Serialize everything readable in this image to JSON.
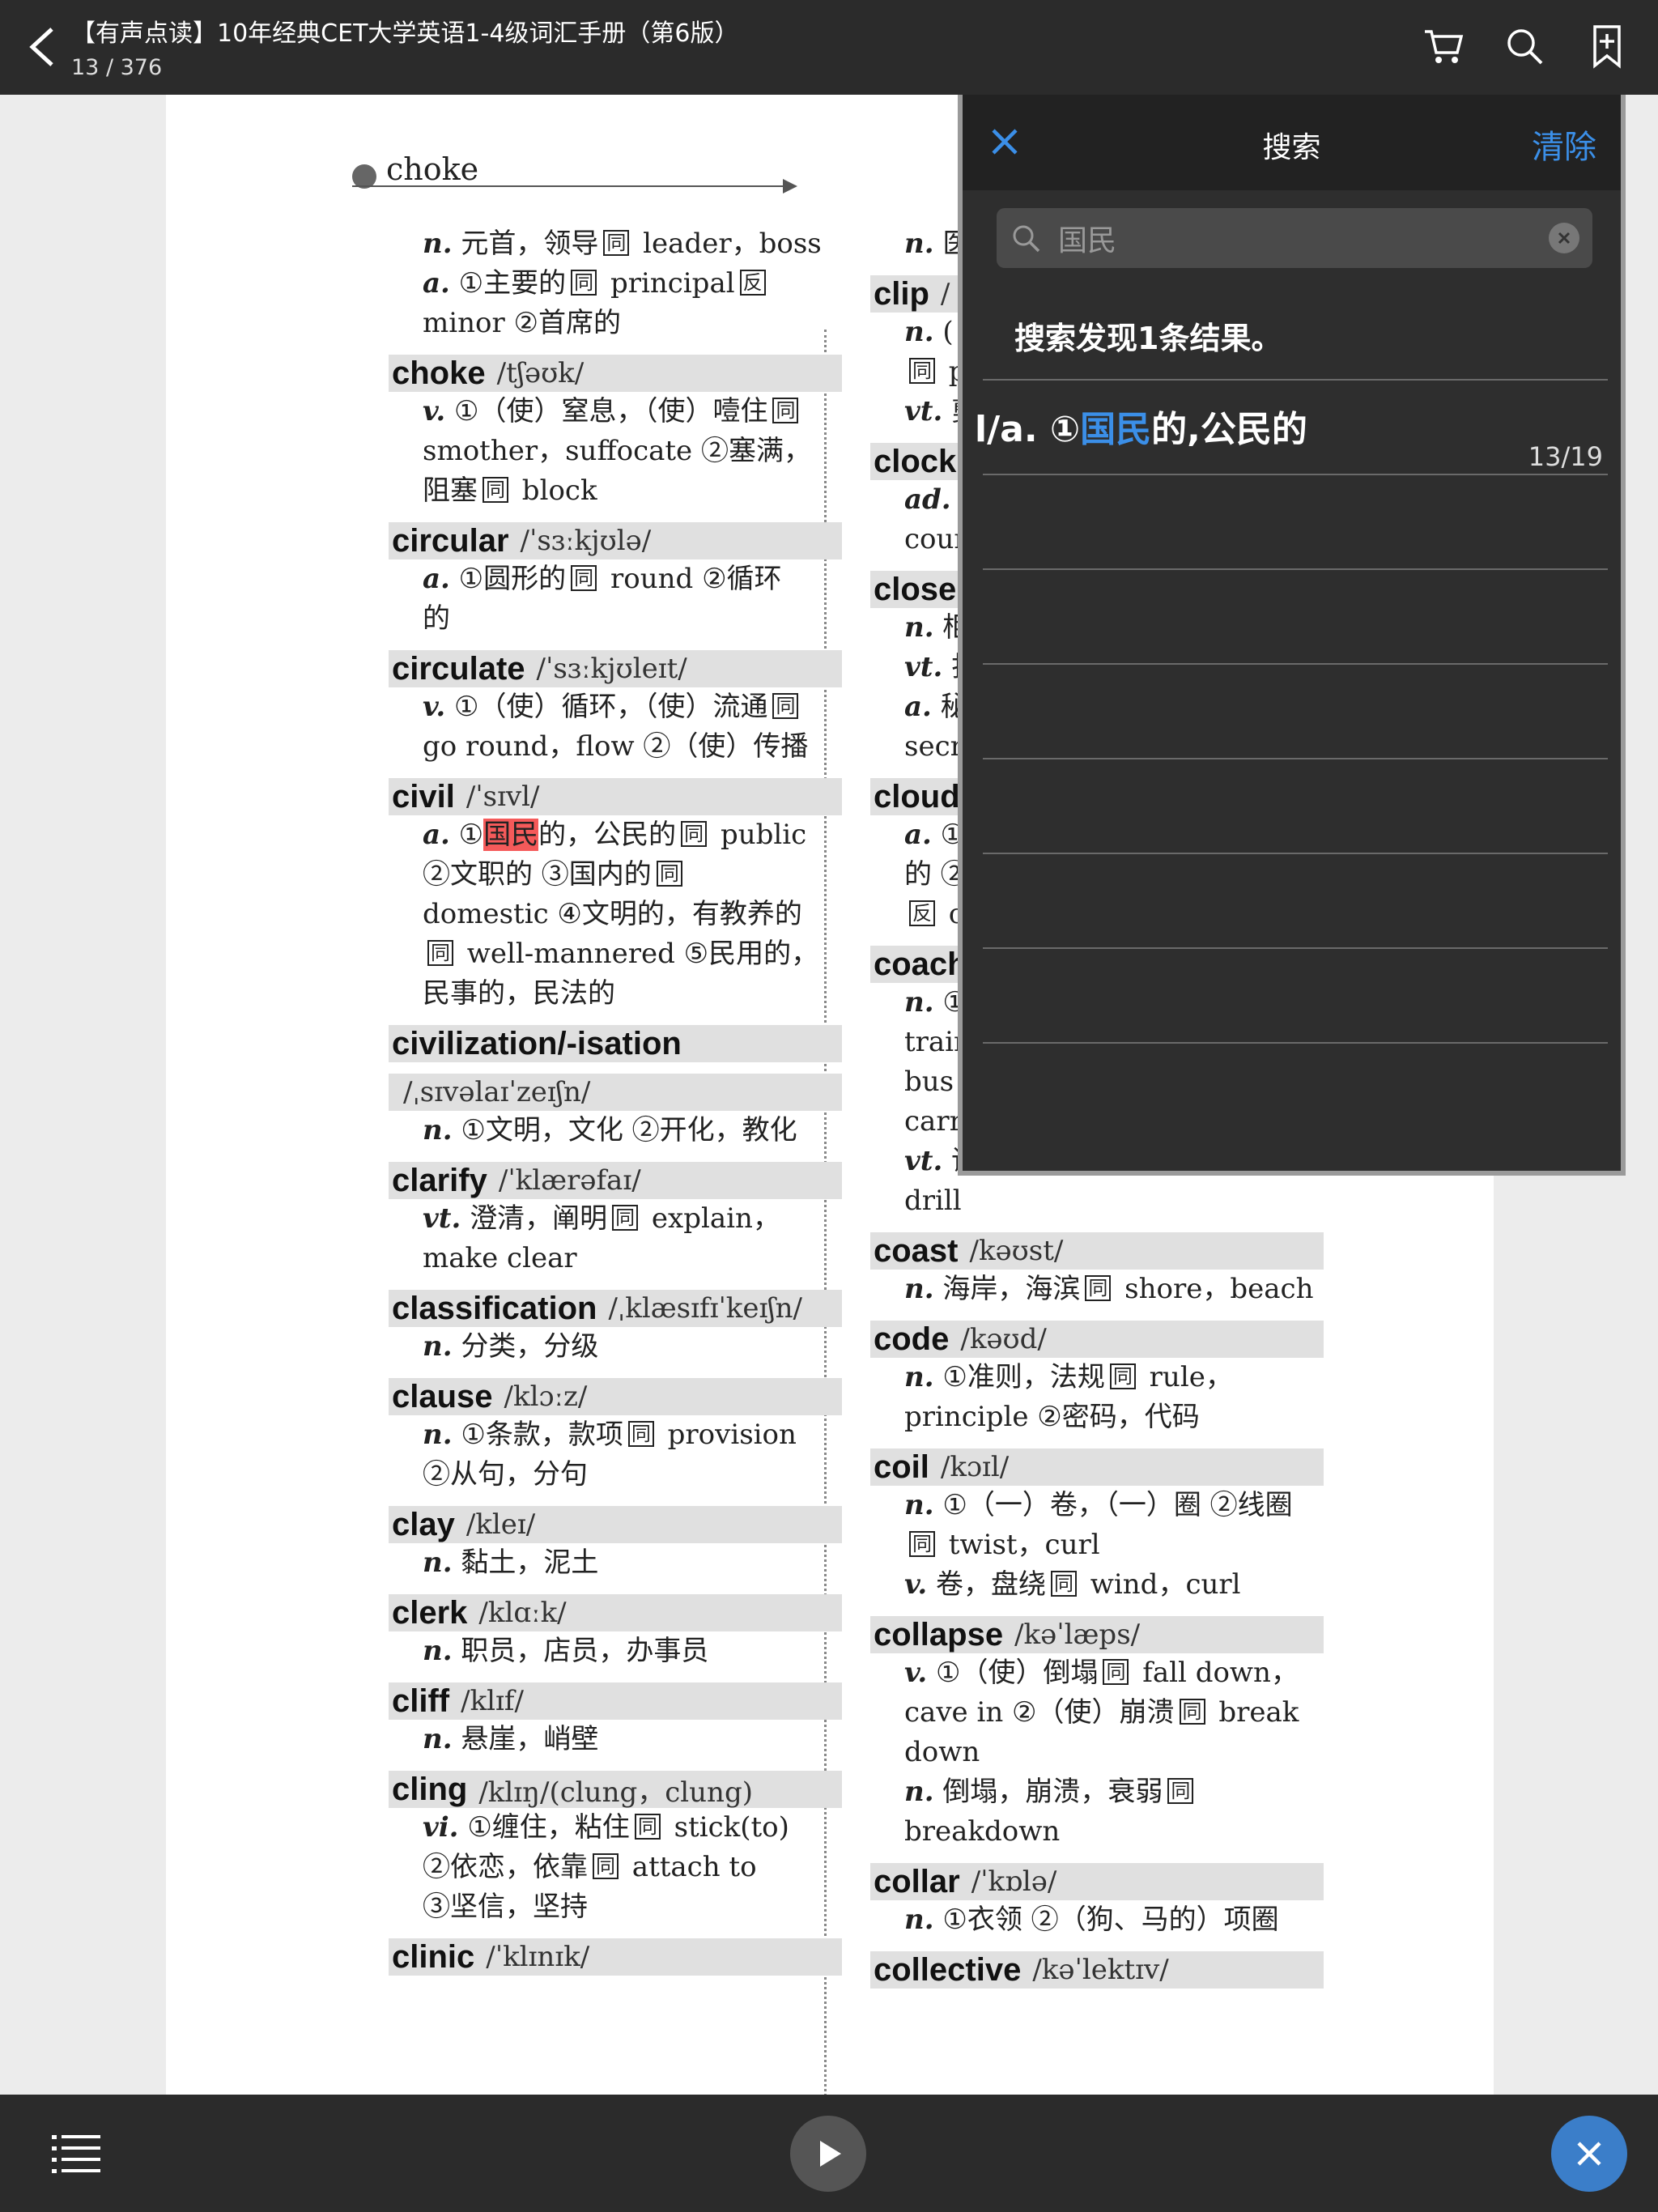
{
  "topbar": {
    "title": "【有声点读】10年经典CET大学英语1-4级词汇手册（第6版）",
    "page": "13 / 376"
  },
  "page_header": {
    "word": "choke"
  },
  "left_entries": [
    {
      "defs": [
        [
          "n.",
          " 元首，领导",
          "同",
          " leader，boss"
        ],
        [
          "a.",
          " ①主要的",
          "同",
          " principal",
          "反",
          ""
        ],
        [
          "",
          "minor ②首席的"
        ]
      ]
    },
    {
      "word": "choke",
      "phon": "/tʃəʊk/",
      "defs": [
        [
          "v.",
          " ①（使）窒息，（使）噎住",
          "同",
          ""
        ],
        [
          "",
          "smother，suffocate ②塞满，"
        ],
        [
          "",
          "阻塞",
          "同",
          " block"
        ]
      ]
    },
    {
      "word": "circular",
      "phon": "/ˈsɜːkjʊlə/",
      "defs": [
        [
          "a.",
          " ①圆形的",
          "同",
          " round ②循环"
        ],
        [
          "",
          "的"
        ]
      ]
    },
    {
      "word": "circulate",
      "phon": "/ˈsɜːkjʊleɪt/",
      "defs": [
        [
          "v.",
          " ①（使）循环，（使）流通",
          "同",
          ""
        ],
        [
          "",
          "go round，flow ②（使）传播"
        ]
      ]
    },
    {
      "word": "civil",
      "phon": "/ˈsɪvl/",
      "defs": [
        [
          "a.",
          " ①",
          "HL:国民",
          "的，公民的",
          "同",
          " public"
        ],
        [
          "",
          "②文职的 ③国内的",
          "同",
          ""
        ],
        [
          "",
          "domestic ④文明的，有教养的"
        ],
        [
          "",
          "",
          "同",
          " well-mannered ⑤民用的，"
        ],
        [
          "",
          "民事的，民法的"
        ]
      ]
    },
    {
      "word": "civilization/-isation",
      "phon": "",
      "defs": []
    },
    {
      "word": "",
      "phon": "/ˌsɪvəlaɪˈzeɪʃn/",
      "defs": [
        [
          "n.",
          " ①文明，文化 ②开化，教化"
        ]
      ]
    },
    {
      "word": "clarify",
      "phon": "/ˈklærəfaɪ/",
      "defs": [
        [
          "vt.",
          " 澄清，阐明",
          "同",
          " explain，"
        ],
        [
          "",
          "make clear"
        ]
      ]
    },
    {
      "word": "classification",
      "phon": "/ˌklæsɪfɪˈkeɪʃn/",
      "defs": [
        [
          "n.",
          " 分类，分级"
        ]
      ]
    },
    {
      "word": "clause",
      "phon": "/klɔːz/",
      "defs": [
        [
          "n.",
          " ①条款，款项",
          "同",
          " provision"
        ],
        [
          "",
          "②从句，分句"
        ]
      ]
    },
    {
      "word": "clay",
      "phon": "/kleɪ/",
      "defs": [
        [
          "n.",
          " 黏土，泥土"
        ]
      ]
    },
    {
      "word": "clerk",
      "phon": "/klɑːk/",
      "defs": [
        [
          "n.",
          " 职员，店员，办事员"
        ]
      ]
    },
    {
      "word": "cliff",
      "phon": "/klɪf/",
      "defs": [
        [
          "n.",
          " 悬崖，峭壁"
        ]
      ]
    },
    {
      "word": "cling",
      "phon": "/klɪŋ/(clung，clung)",
      "defs": [
        [
          "vi.",
          " ①缠住，粘住",
          "同",
          " stick(to)"
        ],
        [
          "",
          "②依恋，依靠",
          "同",
          " attach to"
        ],
        [
          "",
          "③坚信，坚持"
        ]
      ]
    },
    {
      "word": "clinic",
      "phon": "/ˈklɪnɪk/",
      "defs": []
    }
  ],
  "right_entries": [
    {
      "defs": [
        [
          "n.",
          " 医"
        ]
      ]
    },
    {
      "word": "clip",
      "phon": "/",
      "defs": [
        [
          "n.",
          " ("
        ],
        [
          "",
          "",
          "同",
          " pi"
        ],
        [
          "vt.",
          " 剪"
        ]
      ]
    },
    {
      "word": "clock",
      "phon": "",
      "defs": [
        [
          "ad.",
          " /"
        ],
        [
          "",
          "cour"
        ]
      ]
    },
    {
      "word": "close",
      "phon": "",
      "defs": [
        [
          "n.",
          " 柜"
        ],
        [
          "vt.",
          " 打"
        ],
        [
          "a.",
          " 秘"
        ],
        [
          "",
          "secr"
        ]
      ]
    },
    {
      "word": "cloud",
      "phon": "",
      "defs": [
        [
          "a.",
          " ①"
        ],
        [
          "",
          "的 ②"
        ],
        [
          "",
          "",
          "反",
          " cl"
        ]
      ]
    },
    {
      "word": "coach",
      "phon": "",
      "defs": [
        [
          "n.",
          " ①"
        ],
        [
          "",
          "train"
        ],
        [
          "",
          "bus"
        ],
        [
          "",
          "carr"
        ],
        [
          "vt.",
          " 训练，辅导，指导",
          "同",
          " train，"
        ],
        [
          "",
          "drill"
        ]
      ]
    },
    {
      "word": "coast",
      "phon": "/kəʊst/",
      "defs": [
        [
          "n.",
          " 海岸，海滨",
          "同",
          " shore，beach"
        ]
      ]
    },
    {
      "word": "code",
      "phon": "/kəʊd/",
      "defs": [
        [
          "n.",
          " ①准则，法规",
          "同",
          " rule，"
        ],
        [
          "",
          "principle ②密码，代码"
        ]
      ]
    },
    {
      "word": "coil",
      "phon": "/kɔɪl/",
      "defs": [
        [
          "n.",
          " ①（一）卷，（一）圈 ②线圈"
        ],
        [
          "",
          "",
          "同",
          " twist，curl"
        ],
        [
          "v.",
          " 卷，盘绕",
          "同",
          " wind，curl"
        ]
      ]
    },
    {
      "word": "collapse",
      "phon": "/kəˈlæps/",
      "defs": [
        [
          "v.",
          " ①（使）倒塌",
          "同",
          " fall down，"
        ],
        [
          "",
          "cave in ②（使）崩溃",
          "同",
          " break"
        ],
        [
          "",
          "down"
        ],
        [
          "n.",
          " 倒塌，崩溃，衰弱",
          "同",
          ""
        ],
        [
          "",
          "breakdown"
        ]
      ]
    },
    {
      "word": "collar",
      "phon": "/ˈkɒlə/",
      "defs": [
        [
          "n.",
          " ①衣领 ②（狗、马的）项圈"
        ]
      ]
    },
    {
      "word": "collective",
      "phon": "/kəˈlektɪv/",
      "defs": []
    }
  ],
  "search_panel": {
    "title": "搜索",
    "clear_label": "清除",
    "query": "国民",
    "result_summary": "搜索发现1条结果。",
    "results": [
      {
        "prefix": "l/a. ①",
        "match": "国民",
        "suffix": "的,公民的",
        "page": "13/19"
      }
    ],
    "empty_rows": 7
  },
  "colors": {
    "accent": "#3b8fe8",
    "highlight": "#f55a5a",
    "bar": "#2b2b2b"
  },
  "icons": [
    "back-arrow-icon",
    "cart-icon",
    "search-icon",
    "bookmark-add-icon",
    "close-icon",
    "clear-input-icon",
    "list-icon",
    "play-icon"
  ]
}
